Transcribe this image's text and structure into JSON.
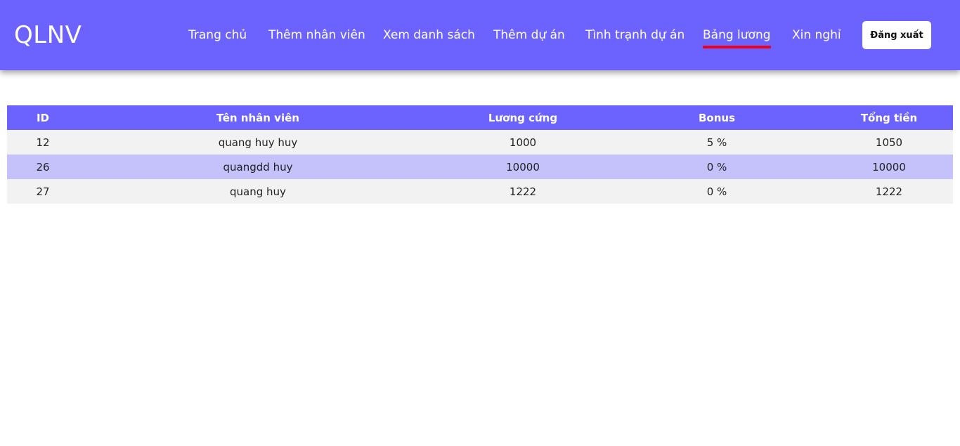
{
  "brand": {
    "logo": "QLNV"
  },
  "nav": {
    "items": [
      {
        "label": "Trang chủ"
      },
      {
        "label": "Thêm nhân viên"
      },
      {
        "label": "Xem danh sách"
      },
      {
        "label": "Thêm dự án"
      },
      {
        "label": "Tình trạnh dự án"
      },
      {
        "label": "Bảng lương",
        "active": true
      },
      {
        "label": "Xin nghỉ"
      }
    ],
    "logout_label": "Đăng xuất"
  },
  "table": {
    "headers": [
      "ID",
      "Tên nhân viên",
      "Lương cứng",
      "Bonus",
      "Tổng tiền"
    ],
    "rows": [
      [
        "12",
        "quang huy huy",
        "1000",
        "5 %",
        "1050"
      ],
      [
        "26",
        "quangdd huy",
        "10000",
        "0 %",
        "10000"
      ],
      [
        "27",
        "quang huy",
        "1222",
        "0 %",
        "1222"
      ]
    ]
  },
  "colors": {
    "primary": "#6c63ff",
    "active_underline": "#e8001c",
    "row_light": "#f2f2f2",
    "row_highlight": "#c4c1fb"
  }
}
